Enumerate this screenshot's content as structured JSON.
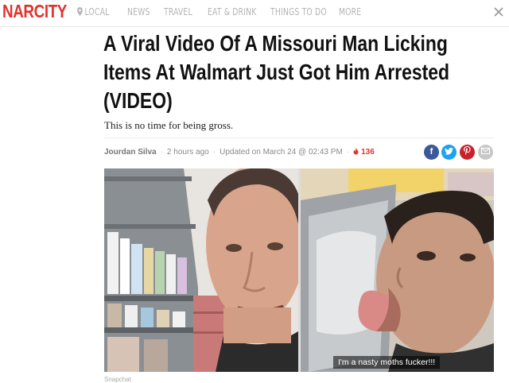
{
  "nav": {
    "logo": "NARCITY",
    "items": [
      "LOCAL",
      "NEWS",
      "TRAVEL",
      "EAT & DRINK",
      "THINGS TO DO",
      "MORE"
    ]
  },
  "article": {
    "title": "A Viral Video Of A Missouri Man Licking Items At Walmart Just Got Him Arrested (VIDEO)",
    "subtitle": "This is no time for being gross.",
    "author": "Jourdan Silva",
    "time_ago": "2 hours ago",
    "updated": "Updated on March 24 @ 02:43 PM",
    "reactions": "136",
    "share": [
      "f",
      "t",
      "p",
      "@"
    ],
    "photo_caption": "I'm a nasty moths fucker!!!",
    "photo_credit": "Snapchat"
  },
  "colors": {
    "brand": "#e2322e",
    "facebook": "#3b5998",
    "twitter": "#1da1f2",
    "pinterest": "#c8232c",
    "mail": "#c8c8c8"
  },
  "icons": [
    "location-pin-icon",
    "close-icon",
    "fire-icon",
    "facebook-icon",
    "twitter-icon",
    "pinterest-icon",
    "mail-icon"
  ]
}
